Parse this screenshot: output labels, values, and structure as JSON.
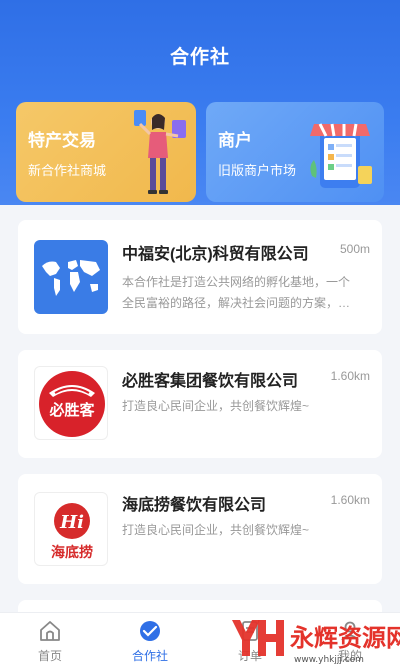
{
  "header": {
    "title": "合作社"
  },
  "banners": [
    {
      "title": "特产交易",
      "subtitle": "新合作社商城"
    },
    {
      "title": "商户",
      "subtitle": "旧版商户市场"
    }
  ],
  "cards": [
    {
      "name": "中福安(北京)科贸有限公司",
      "distance": "500m",
      "desc_line1": "本合作社是打造公共网络的孵化基地，一个",
      "desc_line2": "全民富裕的路径，解决社会问题的方案，…"
    },
    {
      "name": "必胜客集团餐饮有限公司",
      "distance": "1.60km",
      "desc_line1": "打造良心民间企业，共创餐饮辉煌~",
      "logo_text": "必胜客"
    },
    {
      "name": "海底捞餐饮有限公司",
      "distance": "1.60km",
      "desc_line1": "打造良心民间企业，共创餐饮辉煌~",
      "logo_text": "海底捞",
      "logo_mark": "Hi"
    }
  ],
  "nav": [
    {
      "label": "首页"
    },
    {
      "label": "合作社"
    },
    {
      "label": "订单"
    },
    {
      "label": "我的"
    }
  ],
  "watermark": {
    "brand": "永辉资源网",
    "url": "www.yhkjjj.com"
  },
  "colors": {
    "primary": "#2f6fe6",
    "banner_gold": "#f1b84c",
    "banner_blue": "#4f90f3",
    "pizza_red": "#d8222a"
  }
}
